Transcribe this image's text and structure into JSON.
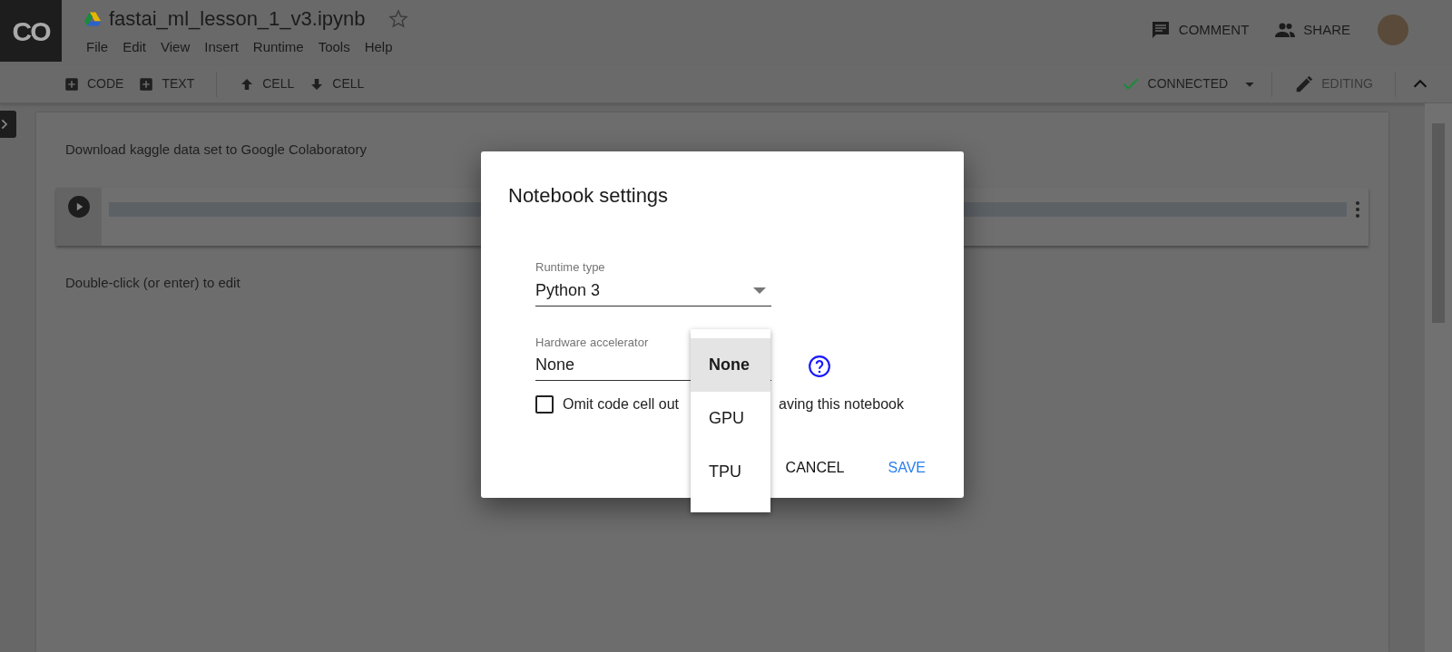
{
  "app": {
    "logo": "CO",
    "title": "fastai_ml_lesson_1_v3.ipynb",
    "starred": false,
    "menu": [
      "File",
      "Edit",
      "View",
      "Insert",
      "Runtime",
      "Tools",
      "Help"
    ],
    "actions": [
      {
        "label": "COMMENT",
        "kind": "comment"
      },
      {
        "label": "SHARE",
        "kind": "share"
      }
    ]
  },
  "toolbar": {
    "items": [
      {
        "label": "CODE",
        "kind": "add"
      },
      {
        "label": "TEXT",
        "kind": "add"
      },
      {
        "label": "CELL",
        "kind": "up"
      },
      {
        "label": "CELL",
        "kind": "down"
      }
    ],
    "status": "CONNECTED",
    "mode": "EDITING"
  },
  "notebook": {
    "cells": [
      {
        "kind": "text",
        "text": "Download kaggle data set to Google Colaboratory"
      },
      {
        "kind": "code"
      },
      {
        "kind": "text",
        "text": "Double-click (or enter) to edit"
      }
    ]
  },
  "dialog": {
    "title": "Notebook settings",
    "fields": [
      {
        "label": "Runtime type",
        "value": "Python 3",
        "open": false
      },
      {
        "label": "Hardware accelerator",
        "value": "None",
        "open": true,
        "options": [
          {
            "label": "None",
            "selected": true
          },
          {
            "label": "GPU",
            "selected": false
          },
          {
            "label": "TPU",
            "selected": false
          }
        ]
      }
    ],
    "checkbox": {
      "label_parts": [
        "Omit code cell out",
        "aving this notebook"
      ],
      "checked": false
    },
    "buttons": [
      {
        "label": "CANCEL",
        "kind": "secondary"
      },
      {
        "label": "SAVE",
        "kind": "primary"
      }
    ]
  }
}
